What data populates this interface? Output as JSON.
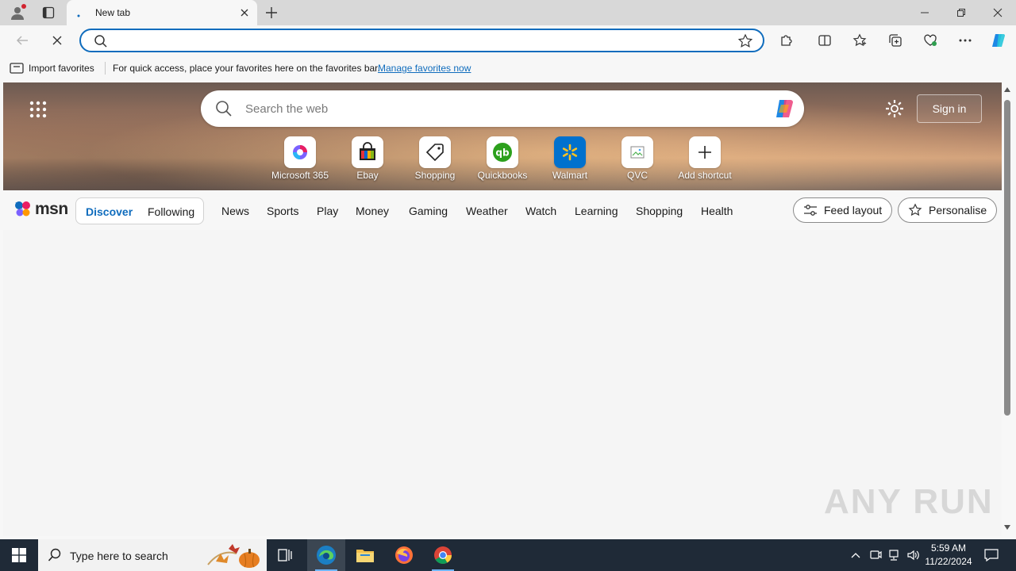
{
  "browser": {
    "tab": {
      "title": "New tab"
    },
    "window_controls": [
      "minimize",
      "restore",
      "close"
    ],
    "address_bar": {
      "value": "",
      "placeholder": ""
    },
    "favorites_bar": {
      "import_label": "Import favorites",
      "message": "For quick access, place your favorites here on the favorites bar.",
      "link": "Manage favorites now"
    }
  },
  "msn": {
    "search_placeholder": "Search the web",
    "sign_in": "Sign in",
    "shortcuts": [
      {
        "label": "Microsoft 365",
        "icon": "microsoft-365-icon"
      },
      {
        "label": "Ebay",
        "icon": "ebay-icon"
      },
      {
        "label": "Shopping",
        "icon": "shopping-tag-icon"
      },
      {
        "label": "Quickbooks",
        "icon": "quickbooks-icon"
      },
      {
        "label": "Walmart",
        "icon": "walmart-icon"
      },
      {
        "label": "QVC",
        "icon": "broken-image-icon"
      },
      {
        "label": "Add shortcut",
        "icon": "plus-icon"
      }
    ],
    "logo_text": "msn",
    "feed_tabs": {
      "discover": "Discover",
      "following": "Following"
    },
    "nav_items": [
      "News",
      "Sports",
      "Play",
      "Money",
      "Gaming",
      "Weather",
      "Watch",
      "Learning",
      "Shopping",
      "Health"
    ],
    "feed_layout": "Feed layout",
    "personalise": "Personalise"
  },
  "watermark": "ANY RUN",
  "taskbar": {
    "search_placeholder": "Type here to search",
    "time": "5:59 AM",
    "date": "11/22/2024"
  },
  "colors": {
    "accent": "#0f6cbd",
    "taskbar": "#1f2a37"
  }
}
